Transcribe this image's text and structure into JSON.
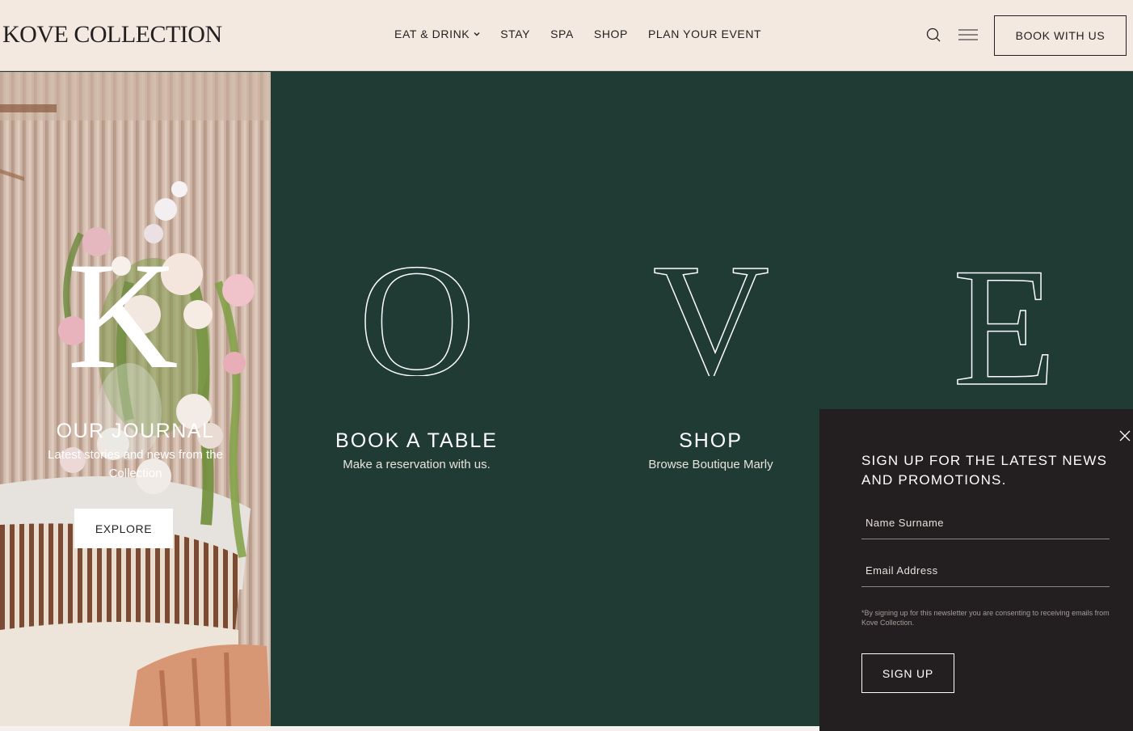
{
  "header": {
    "logo": "KOVE COLLECTION",
    "nav": [
      {
        "label": "EAT & DRINK",
        "has_dropdown": true
      },
      {
        "label": "STAY"
      },
      {
        "label": "SPA"
      },
      {
        "label": "SHOP"
      },
      {
        "label": "PLAN YOUR EVENT"
      }
    ],
    "search_icon": "search-icon",
    "menu_icon": "hamburger-menu-icon",
    "book_button": "BOOK WITH US"
  },
  "panels": [
    {
      "letter": "K",
      "title": "OUR JOURNAL",
      "subtitle": "Latest stories and news from the Collection",
      "button": "EXPLORE"
    },
    {
      "letter": "O",
      "title": "BOOK A TABLE",
      "subtitle": "Make a reservation with us."
    },
    {
      "letter": "V",
      "title": "SHOP",
      "subtitle": "Browse Boutique Marly"
    },
    {
      "letter": "E"
    }
  ],
  "popup": {
    "title": "SIGN UP FOR THE LATEST NEWS AND PROMOTIONS.",
    "name_placeholder": "Name Surname",
    "email_placeholder": "Email Address",
    "consent": "*By signing up for this newsletter you are consenting to receiving emails from Kove Collection.",
    "button": "SIGN UP",
    "close_icon": "close-icon"
  },
  "colors": {
    "header_bg": "#f4e9e1",
    "panel_green": "#1f3b34",
    "popup_bg": "#231f20",
    "text_dark": "#231f20"
  }
}
